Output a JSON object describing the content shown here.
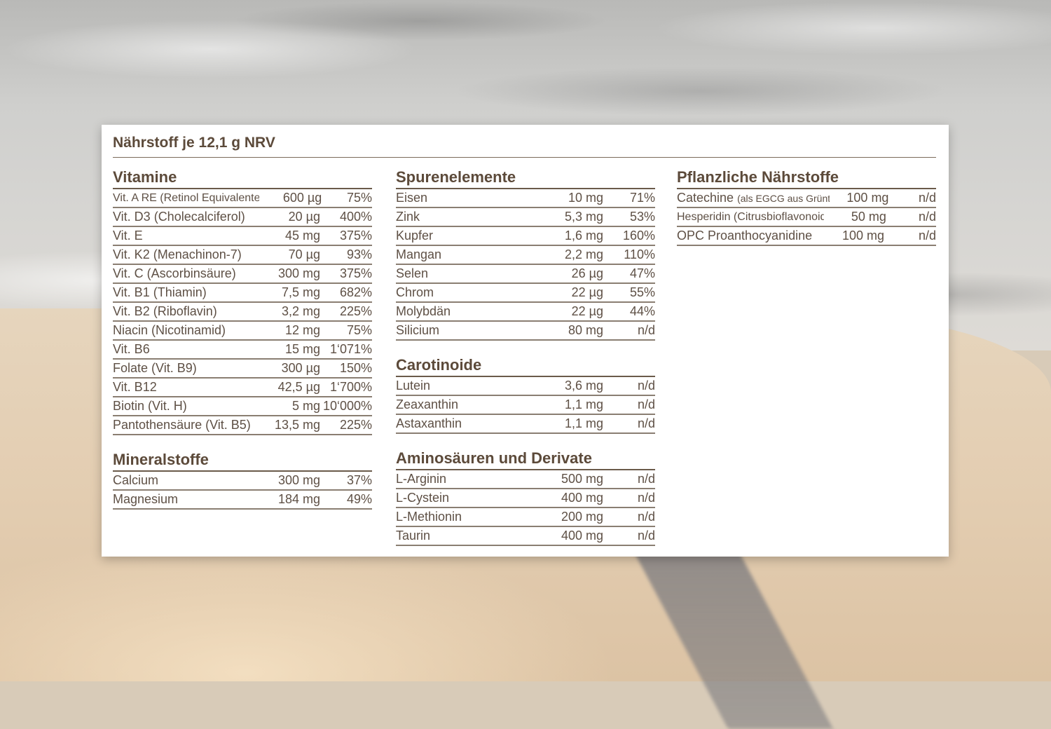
{
  "title": "Nährstoff je 12,1 g NRV",
  "sections": {
    "vitamine": {
      "title": "Vitamine",
      "rows": [
        {
          "name": "Vit. A RE (Retinol Equivalente)",
          "amount": "600 µg",
          "nrv": "75%"
        },
        {
          "name": "Vit. D3 (Cholecalciferol)",
          "amount": "20 µg",
          "nrv": "400%"
        },
        {
          "name": "Vit. E",
          "amount": "45 mg",
          "nrv": "375%"
        },
        {
          "name": "Vit. K2 (Menachinon-7)",
          "amount": "70 µg",
          "nrv": "93%"
        },
        {
          "name": "Vit. C (Ascorbinsäure)",
          "amount": "300 mg",
          "nrv": "375%"
        },
        {
          "name": "Vit. B1 (Thiamin)",
          "amount": "7,5 mg",
          "nrv": "682%"
        },
        {
          "name": "Vit. B2 (Riboflavin)",
          "amount": "3,2 mg",
          "nrv": "225%"
        },
        {
          "name": "Niacin (Nicotinamid)",
          "amount": "12 mg",
          "nrv": "75%"
        },
        {
          "name": "Vit. B6",
          "amount": "15 mg",
          "nrv": "1‘071%"
        },
        {
          "name": "Folate (Vit. B9)",
          "amount": "300 µg",
          "nrv": "150%"
        },
        {
          "name": "Vit. B12",
          "amount": "42,5 µg",
          "nrv": "1‘700%"
        },
        {
          "name": "Biotin (Vit. H)",
          "amount": "5 mg",
          "nrv": "10‘000%"
        },
        {
          "name": "Pantothensäure (Vit. B5)",
          "amount": "13,5 mg",
          "nrv": "225%"
        }
      ]
    },
    "mineralstoffe": {
      "title": "Mineralstoffe",
      "rows": [
        {
          "name": "Calcium",
          "amount": "300 mg",
          "nrv": "37%"
        },
        {
          "name": "Magnesium",
          "amount": "184 mg",
          "nrv": "49%"
        }
      ]
    },
    "spurenelemente": {
      "title": "Spurenelemente",
      "rows": [
        {
          "name": "Eisen",
          "amount": "10 mg",
          "nrv": "71%"
        },
        {
          "name": "Zink",
          "amount": "5,3 mg",
          "nrv": "53%"
        },
        {
          "name": "Kupfer",
          "amount": "1,6 mg",
          "nrv": "160%"
        },
        {
          "name": "Mangan",
          "amount": "2,2 mg",
          "nrv": "110%"
        },
        {
          "name": "Selen",
          "amount": "26 µg",
          "nrv": "47%"
        },
        {
          "name": "Chrom",
          "amount": "22 µg",
          "nrv": "55%"
        },
        {
          "name": "Molybdän",
          "amount": "22 µg",
          "nrv": "44%"
        },
        {
          "name": "Silicium",
          "amount": "80 mg",
          "nrv": "n/d"
        }
      ]
    },
    "carotinoide": {
      "title": "Carotinoide",
      "rows": [
        {
          "name": "Lutein",
          "amount": "3,6 mg",
          "nrv": "n/d"
        },
        {
          "name": "Zeaxanthin",
          "amount": "1,1 mg",
          "nrv": "n/d"
        },
        {
          "name": "Astaxanthin",
          "amount": "1,1 mg",
          "nrv": "n/d"
        }
      ]
    },
    "aminosaeuren": {
      "title": "Aminosäuren und Derivate",
      "rows": [
        {
          "name": "L-Arginin",
          "amount": "500 mg",
          "nrv": "n/d"
        },
        {
          "name": "L-Cystein",
          "amount": "400 mg",
          "nrv": "n/d"
        },
        {
          "name": "L-Methionin",
          "amount": "200 mg",
          "nrv": "n/d"
        },
        {
          "name": "Taurin",
          "amount": "400 mg",
          "nrv": "n/d"
        }
      ]
    },
    "pflanzliche": {
      "title": "Pflanzliche Nährstoffe",
      "rows": [
        {
          "name": "Catechine",
          "name_note": "(als EGCG aus Grüntee)",
          "amount": "100 mg",
          "nrv": "n/d"
        },
        {
          "name": "Hesperidin (Citrusbioflavonoid)",
          "amount": "50 mg",
          "nrv": "n/d"
        },
        {
          "name": "OPC Proanthocyanidine",
          "amount": "100 mg",
          "nrv": "n/d"
        }
      ]
    }
  }
}
